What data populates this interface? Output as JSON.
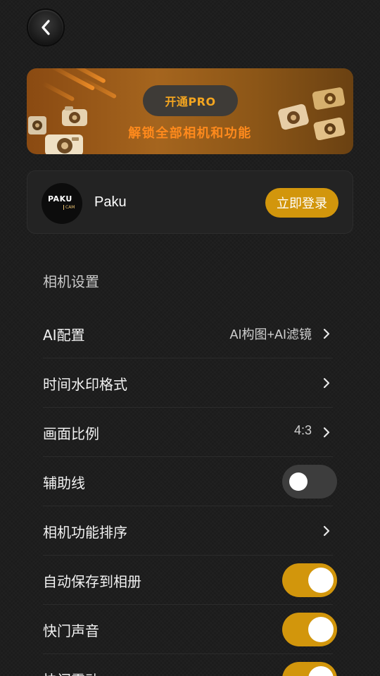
{
  "header": {
    "back_icon": "chevron-left-icon"
  },
  "banner": {
    "pro_label": "开通PRO",
    "subtitle": "解锁全部相机和功能",
    "accent_color": "#f3a520"
  },
  "account": {
    "avatar_text_main": "PAKU",
    "avatar_text_sub": "CAM",
    "name": "Paku",
    "login_label": "立即登录",
    "login_color": "#d2960c"
  },
  "settings": {
    "section_title": "相机设置",
    "items": [
      {
        "label": "AI配置",
        "value": "AI构图+AI滤镜",
        "control": "chevron"
      },
      {
        "label": "时间水印格式",
        "value": "",
        "control": "chevron"
      },
      {
        "label": "画面比例",
        "value": "4:3",
        "control": "chevron"
      },
      {
        "label": "辅助线",
        "value": "",
        "control": "toggle",
        "on": false
      },
      {
        "label": "相机功能排序",
        "value": "",
        "control": "chevron"
      },
      {
        "label": "自动保存到相册",
        "value": "",
        "control": "toggle",
        "on": true
      },
      {
        "label": "快门声音",
        "value": "",
        "control": "toggle",
        "on": true
      },
      {
        "label": "快门震动",
        "value": "",
        "control": "toggle",
        "on": true
      }
    ]
  }
}
